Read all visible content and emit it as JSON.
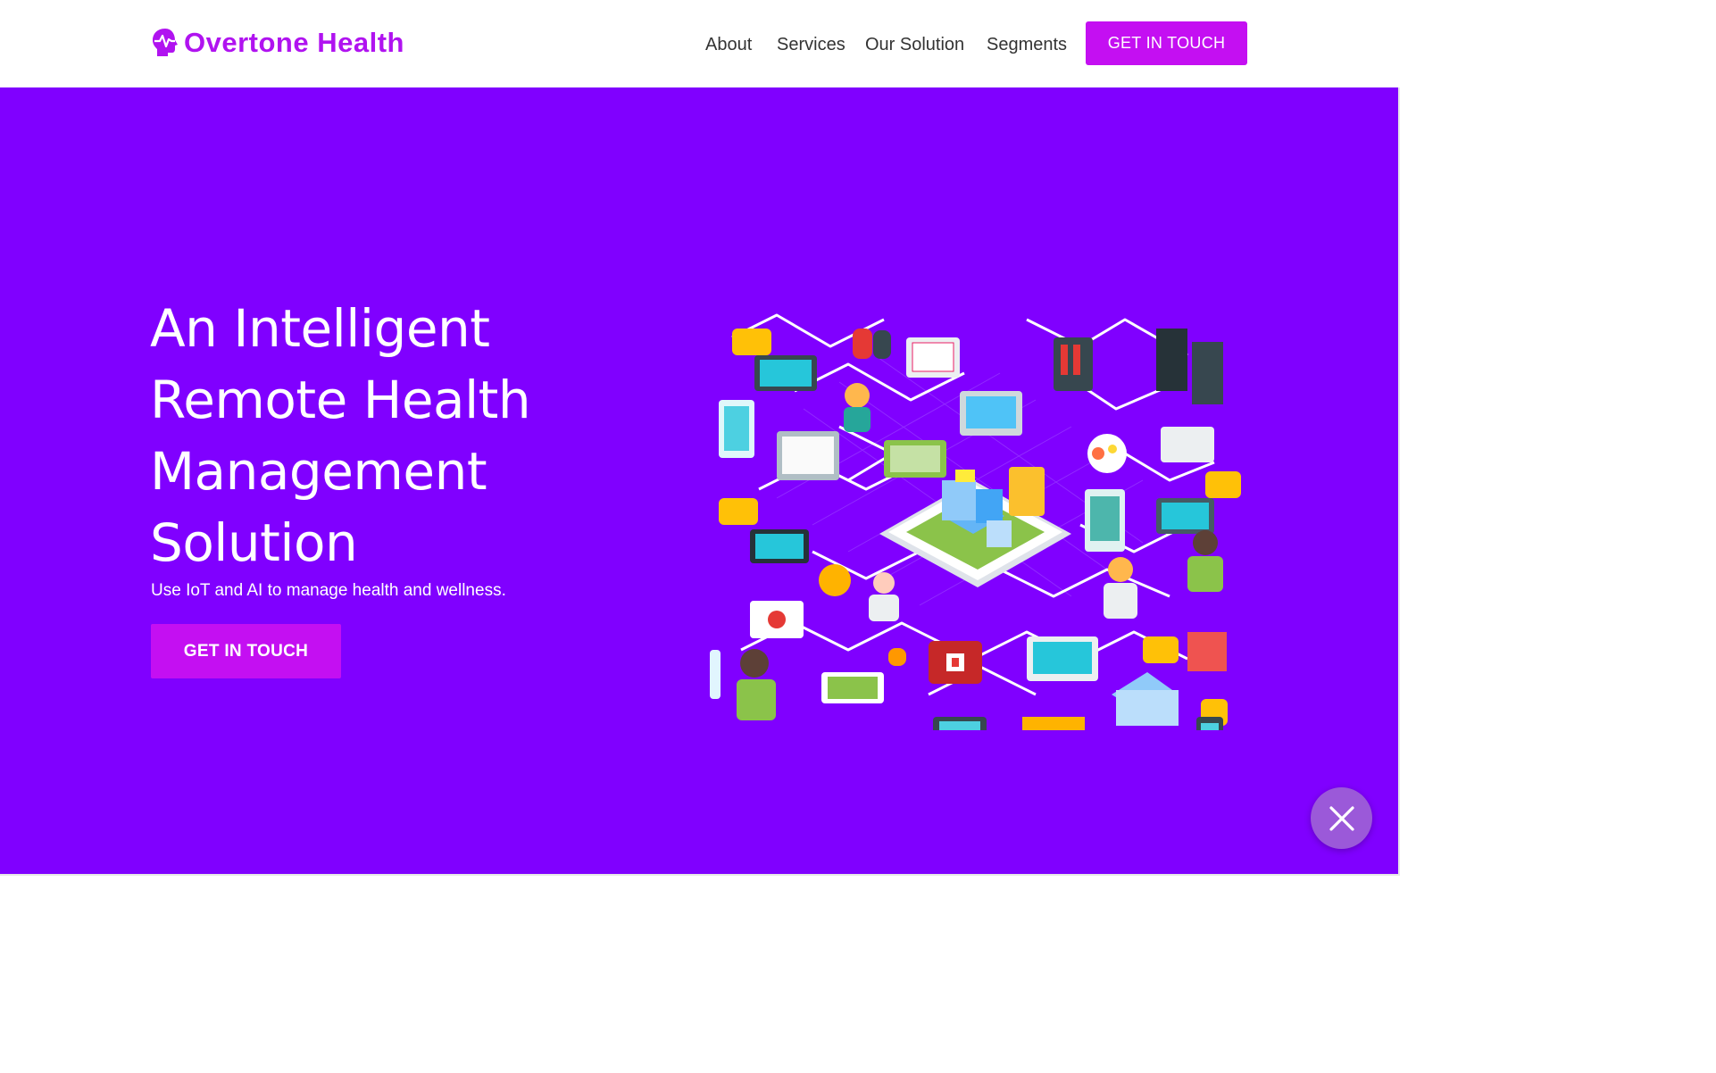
{
  "brand": {
    "name": "Overtone Health",
    "color": "#b013f0"
  },
  "nav": {
    "items": [
      {
        "label": "About"
      },
      {
        "label": "Services"
      },
      {
        "label": "Our Solution"
      },
      {
        "label": "Segments"
      }
    ],
    "cta_label": "GET IN TOUCH"
  },
  "hero": {
    "title_lines": [
      "An Intelligent",
      "Remote Health",
      "Management",
      "Solution"
    ],
    "subtitle": "Use IoT and AI to manage health and wellness.",
    "cta_label": "GET IN TOUCH",
    "background": "#8000ff",
    "illustration": "isometric-healthcare-network-illustration"
  },
  "widgets": {
    "close_icon": "close-icon"
  },
  "colors": {
    "accent": "#c40ff2",
    "hero_bg": "#8000ff",
    "fab": "#9b59d9"
  }
}
